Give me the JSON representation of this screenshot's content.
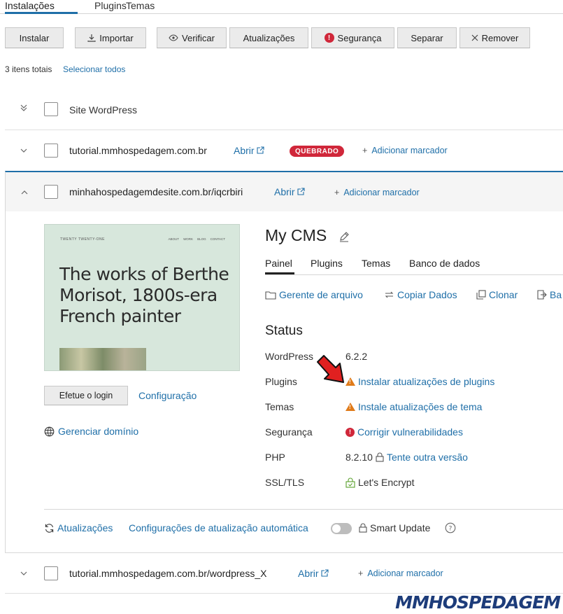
{
  "top_tabs": [
    "Instalações",
    "Plugins",
    "Temas"
  ],
  "toolbar": {
    "install": "Instalar",
    "import": "Importar",
    "verify": "Verificar",
    "updates": "Atualizações",
    "security": "Segurança",
    "separate": "Separar",
    "remove": "Remover"
  },
  "summary": {
    "count_text": "3 itens totais",
    "select_all": "Selecionar todos"
  },
  "group": {
    "name": "Site WordPress"
  },
  "installations": [
    {
      "name": "tutorial.mmhospedagem.com.br",
      "open": "Abrir",
      "badge": "QUEBRADO",
      "add_tag": "Adicionar marcador"
    },
    {
      "name": "minhahospedagemdesite.com.br/iqcrbiri",
      "open": "Abrir",
      "add_tag": "Adicionar marcador"
    },
    {
      "name": "tutorial.mmhospedagem.com.br/wordpress_X",
      "open": "Abrir",
      "add_tag": "Adicionar marcador"
    }
  ],
  "thumbnail": {
    "brand": "TWENTY TWENTY-ONE",
    "nav": [
      "ABOUT",
      "WORK",
      "BLOG",
      "CONTACT"
    ],
    "headline": "The works of Berthe Morisot, 1800s-era French painter"
  },
  "left_panel": {
    "login": "Efetue o login",
    "config": "Configuração",
    "domain": "Gerenciar domínio"
  },
  "cms": {
    "title": "My CMS",
    "tabs": [
      "Painel",
      "Plugins",
      "Temas",
      "Banco de dados"
    ],
    "actions": [
      "Gerente de arquivo",
      "Copiar Dados",
      "Clonar",
      "Ba"
    ]
  },
  "status": {
    "title": "Status",
    "rows": [
      {
        "label": "WordPress",
        "value": "6.2.2"
      },
      {
        "label": "Plugins",
        "value": "Instalar atualizações de plugins"
      },
      {
        "label": "Temas",
        "value": "Instale atualizações de tema"
      },
      {
        "label": "Segurança",
        "value": "Corrigir vulnerabilidades"
      },
      {
        "label": "PHP",
        "value": "8.2.10",
        "extra": "Tente outra versão"
      },
      {
        "label": "SSL/TLS",
        "value": "Let's Encrypt"
      }
    ]
  },
  "bottom": {
    "updates": "Atualizações",
    "auto_update": "Configurações de atualização automática",
    "smart_update": "Smart Update"
  },
  "logo": "MMHOSPEDAGEM",
  "colors": {
    "accent": "#1f6fa8",
    "danger": "#d0273a",
    "warning": "#e07b1a",
    "ok": "#5aa02c"
  }
}
